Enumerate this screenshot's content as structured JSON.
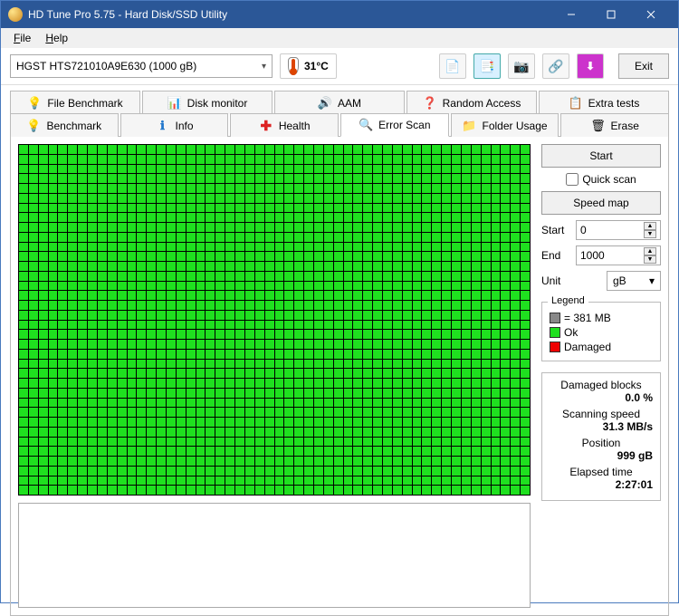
{
  "window": {
    "title": "HD Tune Pro 5.75 - Hard Disk/SSD Utility"
  },
  "menu": {
    "file": "File",
    "help": "Help"
  },
  "toolbar": {
    "drive": "HGST HTS721010A9E630 (1000 gB)",
    "temperature": "31°C",
    "exit": "Exit"
  },
  "tabs": {
    "row1": [
      "File Benchmark",
      "Disk monitor",
      "AAM",
      "Random Access",
      "Extra tests"
    ],
    "row2": [
      "Benchmark",
      "Info",
      "Health",
      "Error Scan",
      "Folder Usage",
      "Erase"
    ],
    "active": "Error Scan"
  },
  "scan": {
    "start_btn": "Start",
    "quick_scan": "Quick scan",
    "speed_map": "Speed map",
    "start_label": "Start",
    "start_value": "0",
    "end_label": "End",
    "end_value": "1000",
    "unit_label": "Unit",
    "unit_value": "gB"
  },
  "legend": {
    "title": "Legend",
    "block_size": "= 381 MB",
    "ok": "Ok",
    "damaged": "Damaged"
  },
  "stats": {
    "damaged_label": "Damaged blocks",
    "damaged_value": "0.0 %",
    "speed_label": "Scanning speed",
    "speed_value": "31.3 MB/s",
    "position_label": "Position",
    "position_value": "999 gB",
    "elapsed_label": "Elapsed time",
    "elapsed_value": "2:27:01"
  }
}
